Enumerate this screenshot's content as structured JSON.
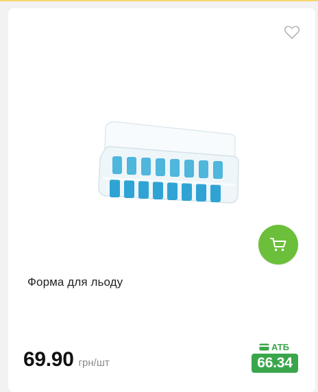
{
  "product": {
    "title": "Форма для льоду",
    "price": "69.90",
    "unit": "грн/шт",
    "card_price_label": "АТБ",
    "card_price": "66.34"
  },
  "icons": {
    "favorite": "heart-outline-icon",
    "cart": "shopping-cart-icon",
    "loyalty_card": "card-icon"
  },
  "colors": {
    "cart_button": "#6cbf3a",
    "atb_green": "#3aa64b",
    "top_accent": "#f5d76e"
  }
}
